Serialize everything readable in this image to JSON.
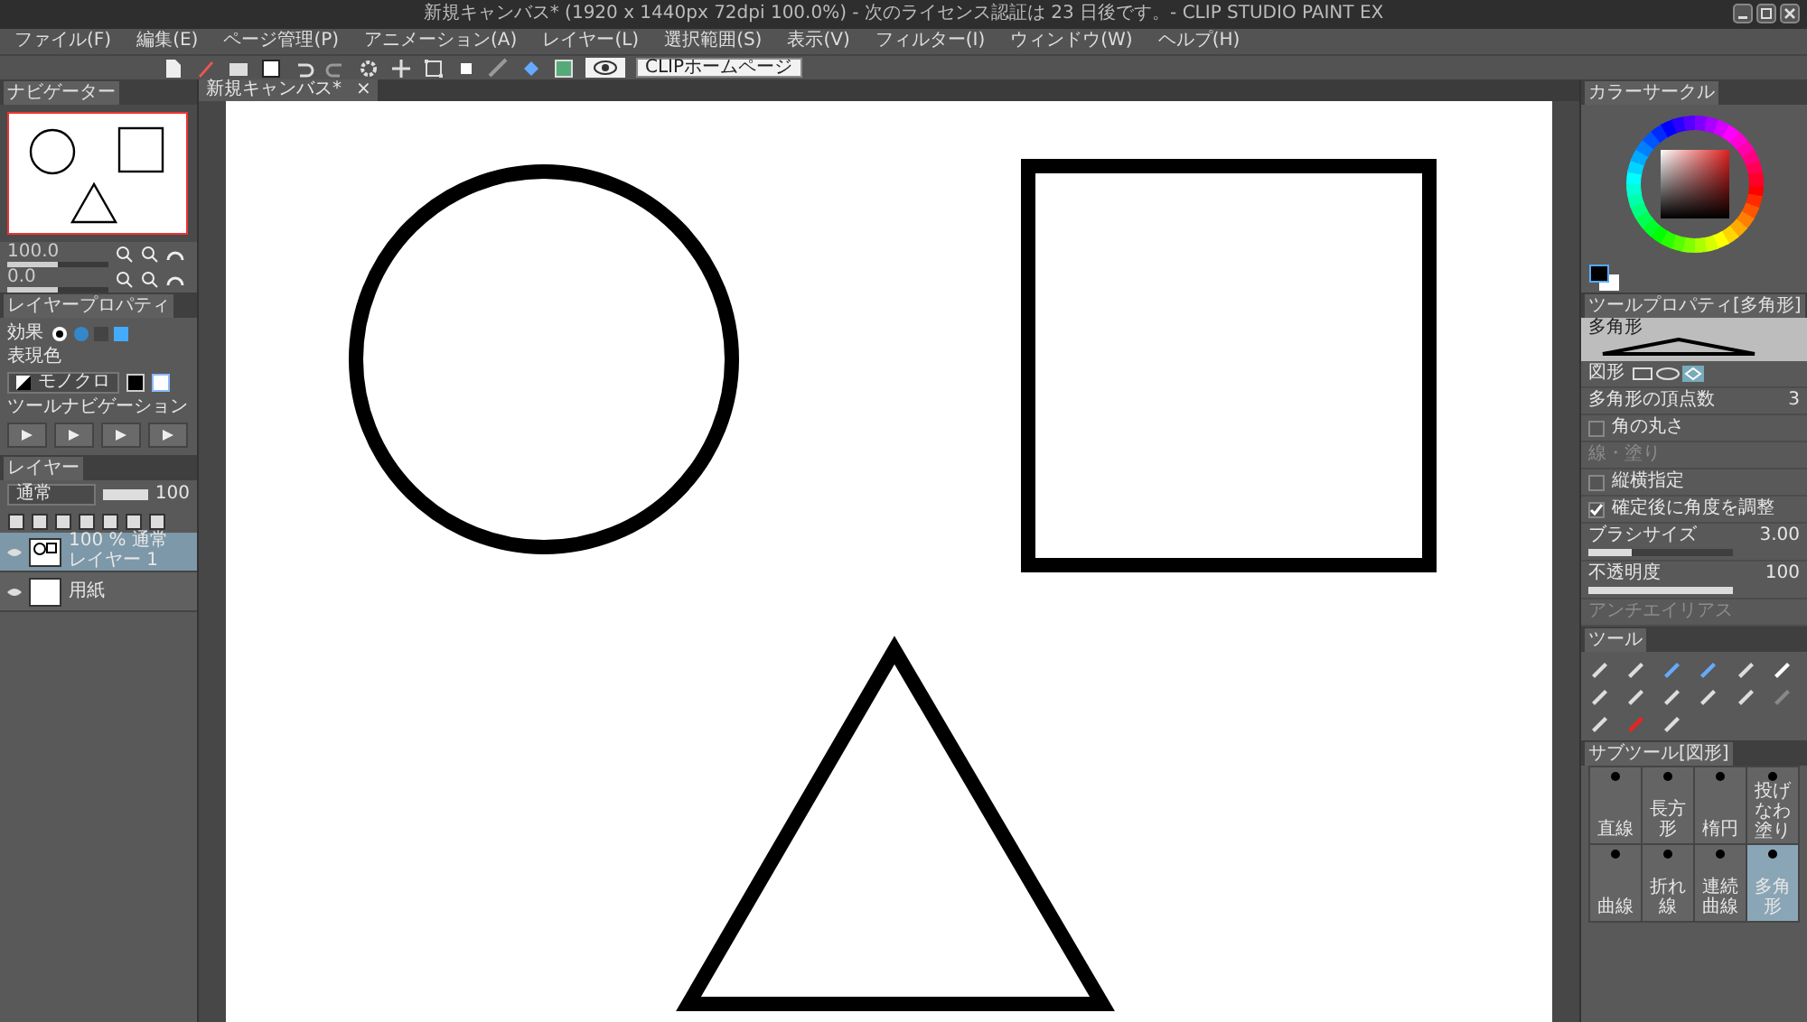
{
  "window": {
    "title": "新規キャンバス* (1920 x 1440px 72dpi 100.0%) - 次のライセンス認証は 23 日後です。- CLIP STUDIO PAINT EX"
  },
  "menu": [
    "ファイル(F)",
    "編集(E)",
    "ページ管理(P)",
    "アニメーション(A)",
    "レイヤー(L)",
    "選択範囲(S)",
    "表示(V)",
    "フィルター(I)",
    "ウィンドウ(W)",
    "ヘルプ(H)"
  ],
  "toolbar": {
    "link_button": "CLIPホームページ"
  },
  "document_tab": {
    "label": "新規キャンバス*",
    "close": "×"
  },
  "navigator": {
    "tab": "ナビゲーター",
    "zoom": {
      "value": "100.0",
      "level": 0.5
    },
    "rotate": {
      "value": "0.0",
      "level": 0.5
    }
  },
  "layer_property": {
    "tab": "レイヤープロパティ",
    "effect_label": "効果",
    "color_label": "表現色",
    "color_mode": "モノクロ",
    "tool_nav_label": "ツールナビゲーション"
  },
  "layers_panel": {
    "tab": "レイヤー",
    "blend_mode": "通常",
    "opacity": {
      "value": "100",
      "level": 1
    },
    "layers": [
      {
        "info": "100 % 通常",
        "name": "レイヤー 1",
        "selected": true
      },
      {
        "name": "用紙",
        "selected": false
      }
    ]
  },
  "color_panel": {
    "tab": "カラーサークル"
  },
  "tool_property": {
    "tab": "ツールプロパティ[多角形]",
    "preset": "多角形",
    "rows": [
      {
        "kind": "section",
        "label": "図形"
      },
      {
        "kind": "number",
        "label": "多角形の頂点数",
        "value": "3"
      },
      {
        "kind": "check",
        "label": "角の丸さ",
        "checked": false
      },
      {
        "kind": "disabled",
        "label": "線・塗り"
      },
      {
        "kind": "check",
        "label": "縦横指定",
        "checked": false
      },
      {
        "kind": "check",
        "label": "確定後に角度を調整",
        "checked": true
      },
      {
        "kind": "slider",
        "label": "ブラシサイズ",
        "value": "3.00",
        "level": 0.3
      },
      {
        "kind": "slider",
        "label": "不透明度",
        "value": "100",
        "level": 1
      },
      {
        "kind": "disabled",
        "label": "アンチエイリアス"
      }
    ]
  },
  "tool_panel": {
    "tab": "ツール"
  },
  "subtool_panel": {
    "tab": "サブツール[図形]",
    "items": [
      {
        "label": "直線",
        "selected": false
      },
      {
        "label": "長方形",
        "selected": false
      },
      {
        "label": "楕円",
        "selected": false
      },
      {
        "label": "投げなわ塗り",
        "selected": false
      },
      {
        "label": "曲線",
        "selected": false
      },
      {
        "label": "折れ線",
        "selected": false
      },
      {
        "label": "連続曲線",
        "selected": false
      },
      {
        "label": "多角形",
        "selected": true
      }
    ]
  }
}
